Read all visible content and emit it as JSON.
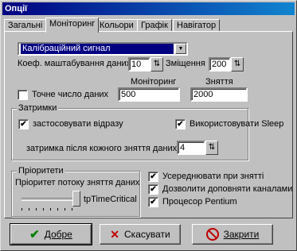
{
  "window": {
    "title": "Опції"
  },
  "tabs": [
    "Загальні",
    "Моніторинг",
    "Кольори",
    "Графік",
    "Навігатор"
  ],
  "monitoring": {
    "signal_select": "Калібраційний сигнал",
    "scale_label": "Коеф. маштабування даних",
    "scale_value": "10",
    "shift_label": "Зміщення",
    "shift_value": "200",
    "monitoring_header": "Моніторинг",
    "capture_header": "Зняття",
    "exact_count_label": "Точне число даних",
    "exact_count_checked": false,
    "monitoring_value": "500",
    "capture_value": "2000"
  },
  "delays": {
    "title": "Затримки",
    "apply_immediately_label": "застосовувати відразу",
    "apply_immediately_checked": true,
    "use_sleep_label": "Використовувати Sleep",
    "use_sleep_checked": true,
    "after_capture_label": "затримка після кожного зняття даних",
    "after_capture_value": "4"
  },
  "priorities": {
    "title": "Пріоритети",
    "thread_label": "Пріоритет потоку зняття даних",
    "thread_value_label": "tpTimeCritical"
  },
  "options": [
    {
      "label": "Усереднювати при знятті",
      "checked": true
    },
    {
      "label": "Дозволити доповняти каналами",
      "checked": true
    },
    {
      "label": "Процесор Pentium",
      "checked": true
    }
  ],
  "buttons": {
    "ok": "Добре",
    "cancel": "Скасувати",
    "close": "Закрити"
  },
  "icons": {
    "check_mark": "✔",
    "spin": "⇅",
    "dropdown": "▼"
  },
  "colors": {
    "ok_icon": "#008000",
    "cancel_icon": "#c00000",
    "close_icon": "#c00000",
    "title_bar": "#000080"
  }
}
